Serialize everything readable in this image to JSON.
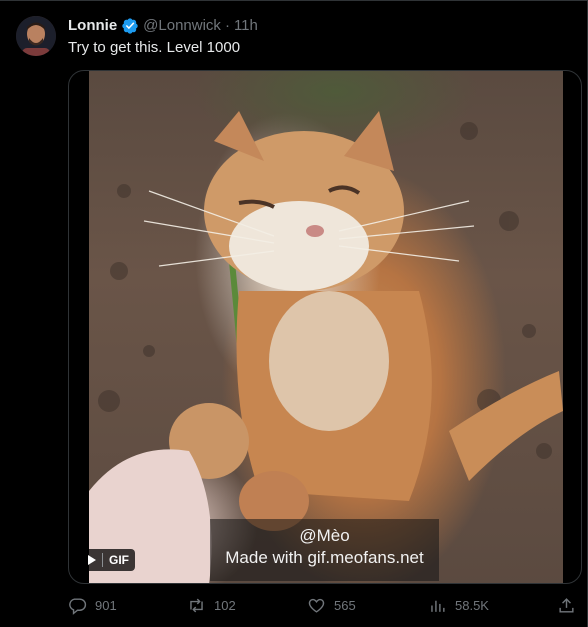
{
  "tweet": {
    "author_name": "Lonnie",
    "author_handle": "@Lonnwick",
    "separator": "·",
    "time": "11h",
    "text": "Try to get this. Level 1000",
    "verified": true
  },
  "media": {
    "gif_label": "GIF",
    "watermark_line1": "@Mèo",
    "watermark_line2": "Made with gif.meofans.net"
  },
  "actions": {
    "replies": "901",
    "retweets": "102",
    "likes": "565",
    "views": "58.5K"
  },
  "colors": {
    "background": "#000000",
    "text_primary": "#e7e9ea",
    "text_secondary": "#71767b",
    "verified": "#1d9bf0",
    "border": "#2f3336"
  }
}
